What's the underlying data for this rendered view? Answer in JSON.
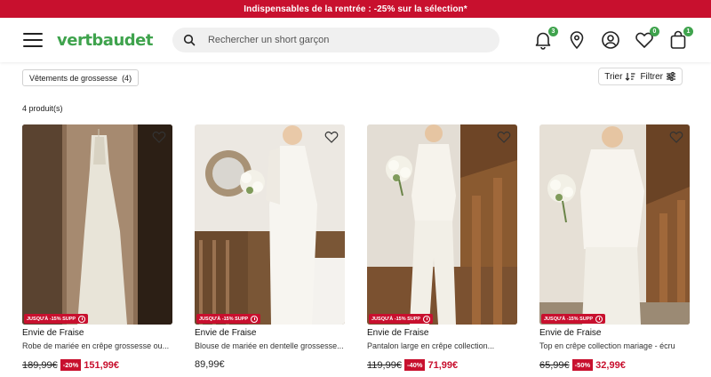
{
  "promo": {
    "text": "Indispensables de la rentrée : -25% sur la sélection*"
  },
  "header": {
    "logo": "vertbaudet",
    "search_placeholder": "Rechercher un short garçon",
    "notifications_count": "3",
    "wishlist_count": "0",
    "cart_count": "1",
    "icons": [
      "menu-icon",
      "search-icon",
      "bell-icon",
      "location-pin-icon",
      "account-icon",
      "heart-icon",
      "bag-icon"
    ]
  },
  "filters": {
    "category_chip": "Vêtements de grossesse",
    "category_count": "(4)",
    "sort_label": "Trier",
    "filter_label": "Filtrer"
  },
  "results": {
    "count_label": "4 produit(s)"
  },
  "promo_tag": "JUSQU'À -15% SUPP",
  "products": [
    {
      "brand": "Envie de Fraise",
      "name": "Robe de mariée en crêpe grossesse ou...",
      "old_price": "189,99€",
      "discount": "-20%",
      "price": "151,99€",
      "has_promo_tag": true
    },
    {
      "brand": "Envie de Fraise",
      "name": "Blouse de mariée en dentelle grossesse...",
      "old_price": "",
      "discount": "",
      "price": "89,99€",
      "has_promo_tag": true
    },
    {
      "brand": "Envie de Fraise",
      "name": "Pantalon large en crêpe collection...",
      "old_price": "119,99€",
      "discount": "-40%",
      "price": "71,99€",
      "has_promo_tag": true
    },
    {
      "brand": "Envie de Fraise",
      "name": "Top en crêpe collection mariage - écru",
      "old_price": "65,99€",
      "discount": "-50%",
      "price": "32,99€",
      "has_promo_tag": true
    }
  ],
  "colors": {
    "brand_green": "#3fa34d",
    "promo_red": "#c8102e"
  }
}
